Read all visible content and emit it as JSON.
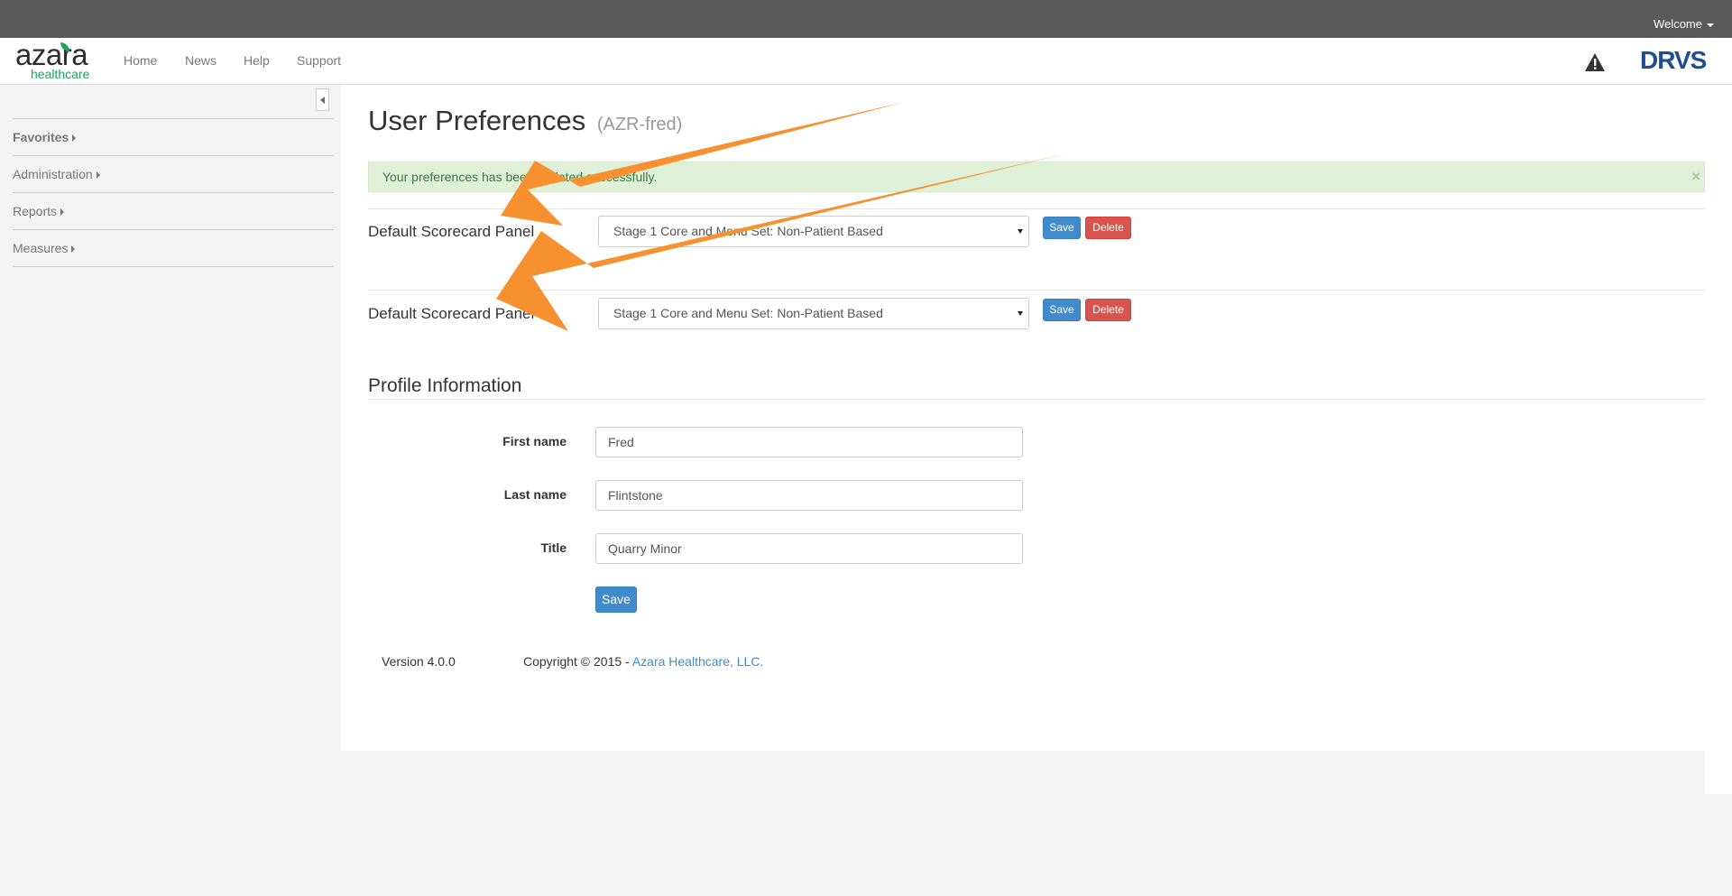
{
  "header": {
    "welcome_label": "Welcome"
  },
  "brand": {
    "logo_wordmark": "azara",
    "logo_sub": "healthcare",
    "product": "DRVS"
  },
  "nav": {
    "items": [
      "Home",
      "News",
      "Help",
      "Support"
    ]
  },
  "sidebar": {
    "items": [
      "Favorites",
      "Administration",
      "Reports",
      "Measures"
    ]
  },
  "page": {
    "title": "User Preferences",
    "user": "(AZR-fred)"
  },
  "alert": {
    "message": "Your preferences has been updated successfully.",
    "close": "×"
  },
  "preferences": [
    {
      "label": "Default Scorecard Panel",
      "value": "Stage 1 Core and Menu Set: Non-Patient Based",
      "save": "Save",
      "delete": "Delete"
    },
    {
      "label": "Default Scorecard Panel",
      "value": "Stage 1 Core and Menu Set: Non-Patient Based",
      "save": "Save",
      "delete": "Delete"
    }
  ],
  "profile": {
    "title": "Profile Information",
    "fields": [
      {
        "label": "First name",
        "value": "Fred"
      },
      {
        "label": "Last name",
        "value": "Flintstone"
      },
      {
        "label": "Title",
        "value": "Quarry Minor"
      }
    ],
    "save": "Save"
  },
  "footer": {
    "version": "Version 4.0.0",
    "copyright": "Copyright © 2015 - ",
    "company": "Azara Healthcare, LLC."
  },
  "colors": {
    "annotation_arrow": "#f7912f",
    "primary": "#428bca",
    "danger": "#d9534f",
    "alert_bg": "#dff0d8"
  },
  "icons": {
    "warning": "warning-icon",
    "collapse": "collapse-sidebar-icon"
  }
}
